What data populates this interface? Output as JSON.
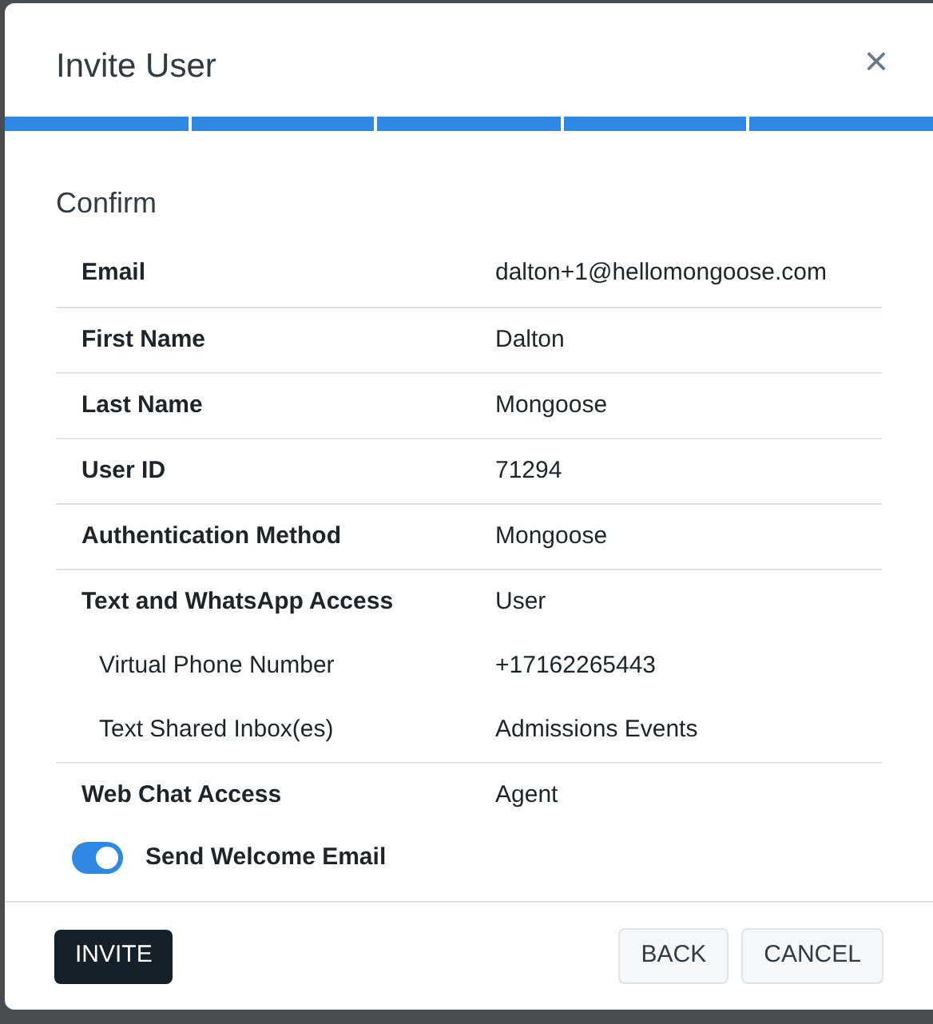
{
  "dialog": {
    "title": "Invite User",
    "close": "×"
  },
  "steps": [
    {
      "done": true
    },
    {
      "done": true
    },
    {
      "done": true
    },
    {
      "done": true
    },
    {
      "done": true
    }
  ],
  "section_title": "Confirm",
  "rows": [
    {
      "kind": "main",
      "label": "Email",
      "value": "dalton+1@hellomongoose.com"
    },
    {
      "kind": "main",
      "label": "First Name",
      "value": "Dalton"
    },
    {
      "kind": "main",
      "label": "Last Name",
      "value": "Mongoose"
    },
    {
      "kind": "main",
      "label": "User ID",
      "value": "71294"
    },
    {
      "kind": "main",
      "label": "Authentication Method",
      "value": "Mongoose"
    },
    {
      "kind": "main",
      "label": "Text and WhatsApp Access",
      "value": "User"
    },
    {
      "kind": "sub",
      "label": "Virtual Phone Number",
      "value": "+17162265443"
    },
    {
      "kind": "sub",
      "label": "Text Shared Inbox(es)",
      "value": "Admissions Events"
    },
    {
      "kind": "main",
      "label": "Web Chat Access",
      "value": "Agent"
    }
  ],
  "welcome_toggle": {
    "label": "Send Welcome Email",
    "on": true
  },
  "buttons": {
    "primary": "INVITE",
    "back": "BACK",
    "cancel": "CANCEL"
  }
}
